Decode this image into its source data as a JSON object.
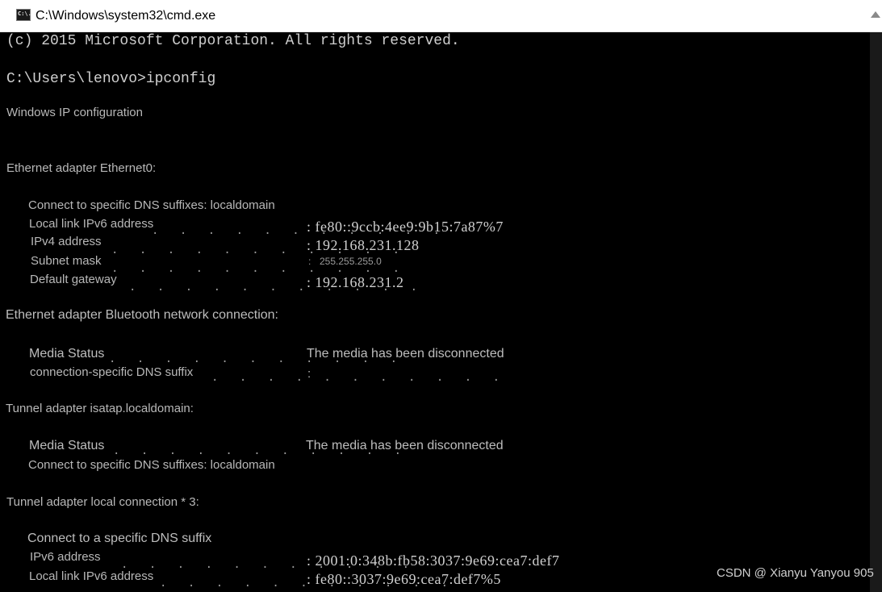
{
  "window": {
    "title": "C:\\Windows\\system32\\cmd.exe",
    "icon": "cmd-app-icon",
    "icon_glyph": "C:\\."
  },
  "console": {
    "copyright": "(c) 2015 Microsoft Corporation. All rights reserved.",
    "prompt": "C:\\Users\\lenovo>ipconfig",
    "header": "Windows IP configuration",
    "eth0": {
      "title": "Ethernet adapter Ethernet0:",
      "dns_suffix": "Connect to specific DNS suffixes: localdomain",
      "ipv6_label": "Local link IPv6 address",
      "ipv6_value": ": fe80::9ccb:4ee9:9b15:7a87%7",
      "ipv4_label": "IPv4 address",
      "ipv4_value": ": 192.168.231.128",
      "mask_label": "Subnet mask",
      "mask_colon": ":",
      "mask_value": "255.255.255.0",
      "gw_label": "Default gateway",
      "gw_value": ": 192.168.231.2"
    },
    "bt": {
      "title": "Ethernet adapter Bluetooth network connection:",
      "media_label": "Media Status",
      "media_value": "The media has been disconnected",
      "dns_label": "connection-specific DNS suffix",
      "dns_colon": ":"
    },
    "isatap": {
      "title": "Tunnel adapter isatap.localdomain:",
      "media_label": "Media Status",
      "media_value": "The media has been disconnected",
      "dns_suffix": "Connect to specific DNS suffixes: localdomain"
    },
    "local3": {
      "title": "Tunnel adapter local connection * 3:",
      "dns_suffix": "Connect to a specific DNS suffix",
      "ipv6_label": "IPv6 address",
      "ipv6_value": ": 2001:0:348b:fb58:3037:9e69:cea7:def7",
      "ll_label": "Local link IPv6 address",
      "ll_value": ": fe80::3037:9e69:cea7:def7%5"
    },
    "dot_leader": ". . . . . . . . . . ."
  },
  "watermark": "CSDN @ Xianyu Yanyou 905",
  "colors": {
    "console_bg": "#000000",
    "console_text": "#c0c0c0",
    "titlebar_bg": "#ffffff"
  }
}
